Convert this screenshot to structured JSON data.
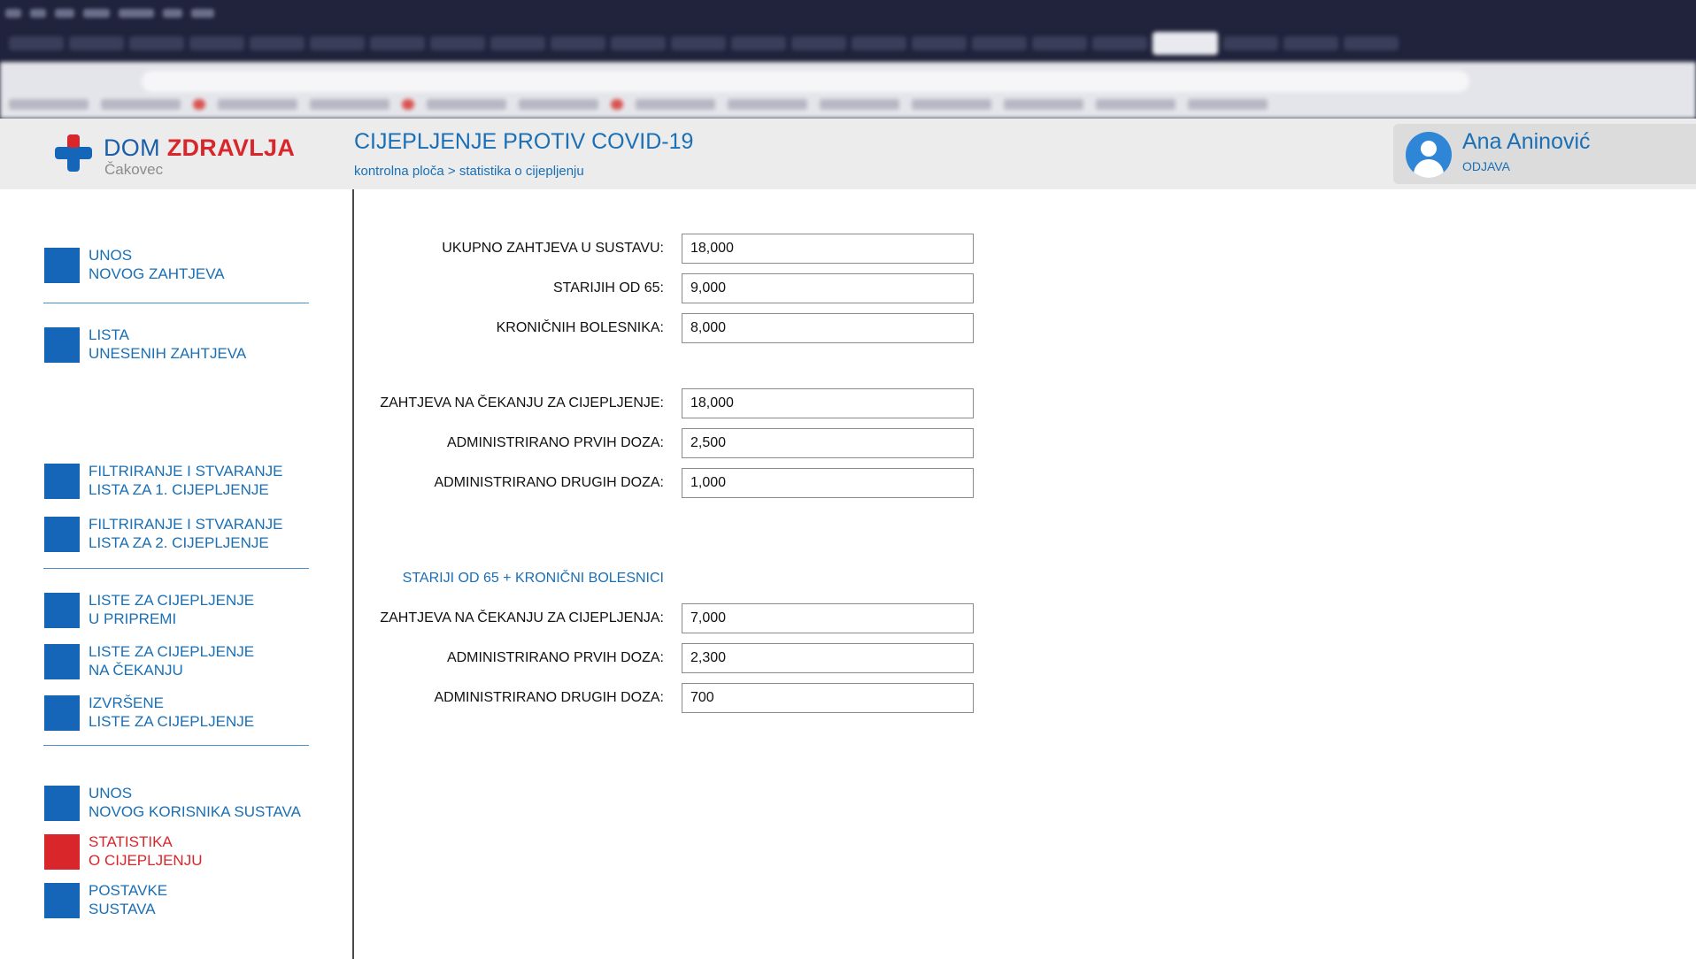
{
  "header": {
    "logo_prefix": "DOM",
    "logo_brand": "ZDRAVLJA",
    "logo_city": "Čakovec",
    "title": "CIJEPLJENJE PROTIV COVID-19",
    "breadcrumb": "kontrolna ploča > statistika o cijepljenju"
  },
  "user": {
    "name": "Ana Aninović",
    "logout_label": "ODJAVA"
  },
  "sidebar": {
    "items": [
      {
        "line1": "UNOS",
        "line2": "NOVOG ZAHTJEVA"
      },
      {
        "line1": "LISTA",
        "line2": "UNESENIH ZAHTJEVA"
      },
      {
        "line1": "FILTRIRANJE I STVARANJE",
        "line2": "LISTA ZA 1. CIJEPLJENJE"
      },
      {
        "line1": "FILTRIRANJE I STVARANJE",
        "line2": "LISTA ZA 2. CIJEPLJENJE"
      },
      {
        "line1": "LISTE ZA CIJEPLJENJE",
        "line2": "U PRIPREMI"
      },
      {
        "line1": "LISTE ZA CIJEPLJENJE",
        "line2": "NA ČEKANJU"
      },
      {
        "line1": "IZVRŠENE",
        "line2": "LISTE ZA CIJEPLJENJE"
      },
      {
        "line1": "UNOS",
        "line2": "NOVOG KORISNIKA SUSTAVA"
      },
      {
        "line1": "STATISTIKA",
        "line2": "O CIJEPLJENJU"
      },
      {
        "line1": "POSTAVKE",
        "line2": "SUSTAVA"
      }
    ],
    "active_item": "STATISTIKA O CIJEPLJENJU"
  },
  "stats": {
    "total_requests": {
      "label": "UKUPNO ZAHTJEVA U SUSTAVU:",
      "value": "18,000"
    },
    "over_65": {
      "label": "STARIJIH OD 65:",
      "value": "9,000"
    },
    "chronic": {
      "label": "KRONIČNIH BOLESNIKA:",
      "value": "8,000"
    },
    "waiting": {
      "label": "ZAHTJEVA NA ČEKANJU ZA CIJEPLJENJE:",
      "value": "18,000"
    },
    "first_doses": {
      "label": "ADMINISTRIRANO PRVIH DOZA:",
      "value": "2,500"
    },
    "second_doses": {
      "label": "ADMINISTRIRANO DRUGIH DOZA:",
      "value": "1,000"
    }
  },
  "priority": {
    "heading": "STARIJI OD 65 + KRONIČNI BOLESNICI",
    "waiting": {
      "label": "ZAHTJEVA NA ČEKANJU ZA CIJEPLJENJA:",
      "value": "7,000"
    },
    "first_doses": {
      "label": "ADMINISTRIRANO PRVIH DOZA:",
      "value": "2,300"
    },
    "second_doses": {
      "label": "ADMINISTRIRANO DRUGIH DOZA:",
      "value": "700"
    }
  },
  "colors": {
    "brand_blue": "#1566b8",
    "brand_red": "#d9262b",
    "header_bg": "#ececec"
  }
}
